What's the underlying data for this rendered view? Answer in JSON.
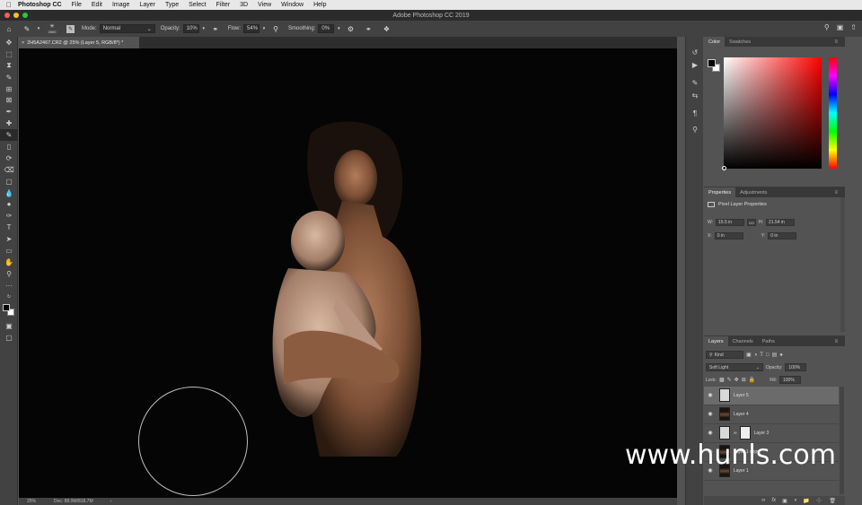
{
  "menubar": {
    "app": "Photoshop CC",
    "items": [
      "File",
      "Edit",
      "Image",
      "Layer",
      "Type",
      "Select",
      "Filter",
      "3D",
      "View",
      "Window",
      "Help"
    ]
  },
  "window": {
    "title": "Adobe Photoshop CC 2019"
  },
  "options": {
    "brush_size": "2500",
    "mode_label": "Mode:",
    "mode_value": "Normal",
    "opacity_label": "Opacity:",
    "opacity_value": "10%",
    "flow_label": "Flow:",
    "flow_value": "54%",
    "smoothing_label": "Smoothing:",
    "smoothing_value": "0%"
  },
  "document": {
    "tab_title": "2H5A2467.CR2 @ 25% (Layer 5, RGB/8*) *"
  },
  "status": {
    "zoom": "25%",
    "doc": "Doc: 88.0M/818.7M"
  },
  "color_panel": {
    "tabs": [
      "Color",
      "Swatches"
    ],
    "active": 0
  },
  "properties_panel": {
    "tabs": [
      "Properties",
      "Adjustments"
    ],
    "subtitle": "Pixel Layer Properties",
    "w_label": "W:",
    "w_value": "15.5 in",
    "h_label": "H:",
    "h_value": "21.54 in",
    "x_label": "X:",
    "x_value": "0 in",
    "y_label": "Y:",
    "y_value": "0 in",
    "go_label": "GO"
  },
  "layers_panel": {
    "tabs": [
      "Layers",
      "Channels",
      "Paths"
    ],
    "filter_value": "Kind",
    "blend_mode": "Soft Light",
    "opacity_label": "Opacity:",
    "opacity_value": "100%",
    "lock_label": "Lock:",
    "fill_label": "Fill:",
    "fill_value": "100%",
    "layers": [
      {
        "name": "Layer 5",
        "thumb": "white",
        "selected": true
      },
      {
        "name": "Layer 4",
        "thumb": "photo",
        "selected": false
      },
      {
        "name": "Layer 3",
        "thumb": "white-mask",
        "selected": false
      },
      {
        "name": "Layer 1 copy",
        "thumb": "photo",
        "selected": false
      },
      {
        "name": "Layer 1",
        "thumb": "photo",
        "selected": false
      }
    ]
  },
  "watermark": "www.hunls.com",
  "colors": {
    "canvas": "#050505",
    "ui_dark": "#424242",
    "ui_mid": "#535353",
    "selected_layer": "#6b6b6b"
  }
}
